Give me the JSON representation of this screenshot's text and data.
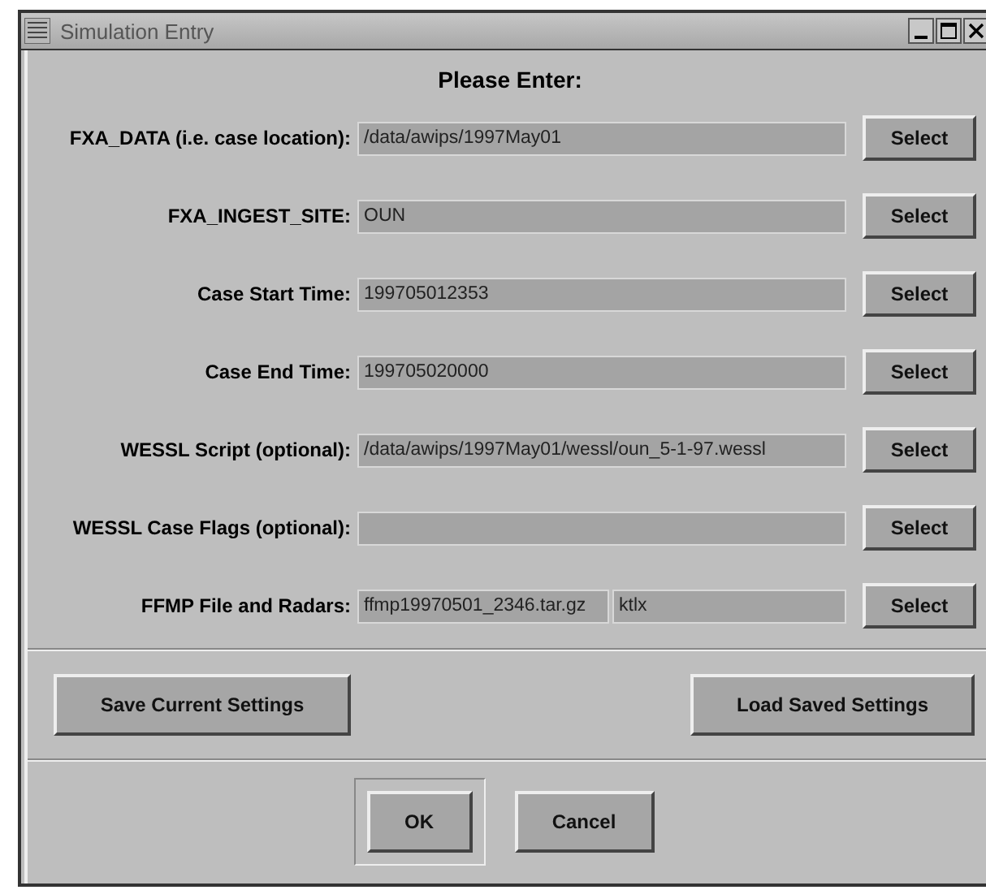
{
  "window": {
    "title": "Simulation Entry"
  },
  "heading": "Please Enter:",
  "rows": [
    {
      "label": "FXA_DATA (i.e. case location):",
      "fields": [
        {
          "value": "/data/awips/1997May01"
        }
      ],
      "button": "Select"
    },
    {
      "label": "FXA_INGEST_SITE:",
      "fields": [
        {
          "value": "OUN"
        }
      ],
      "button": "Select"
    },
    {
      "label": "Case Start Time:",
      "fields": [
        {
          "value": "199705012353"
        }
      ],
      "button": "Select"
    },
    {
      "label": "Case End Time:",
      "fields": [
        {
          "value": "199705020000"
        }
      ],
      "button": "Select"
    },
    {
      "label": "WESSL Script (optional):",
      "fields": [
        {
          "value": "/data/awips/1997May01/wessl/oun_5-1-97.wessl"
        }
      ],
      "button": "Select"
    },
    {
      "label": "WESSL Case Flags (optional):",
      "button": "Select"
    },
    {
      "label": "FFMP File and Radars:",
      "fields": [
        {
          "value": "ffmp19970501_2346.tar.gz"
        },
        {
          "value": "ktlx"
        }
      ],
      "button": "Select"
    }
  ],
  "settings_buttons": [
    "Save Current Settings",
    "Load Saved Settings"
  ],
  "dialog_buttons": [
    {
      "label": "OK",
      "default": true
    },
    {
      "label": "Cancel",
      "default": false
    }
  ]
}
